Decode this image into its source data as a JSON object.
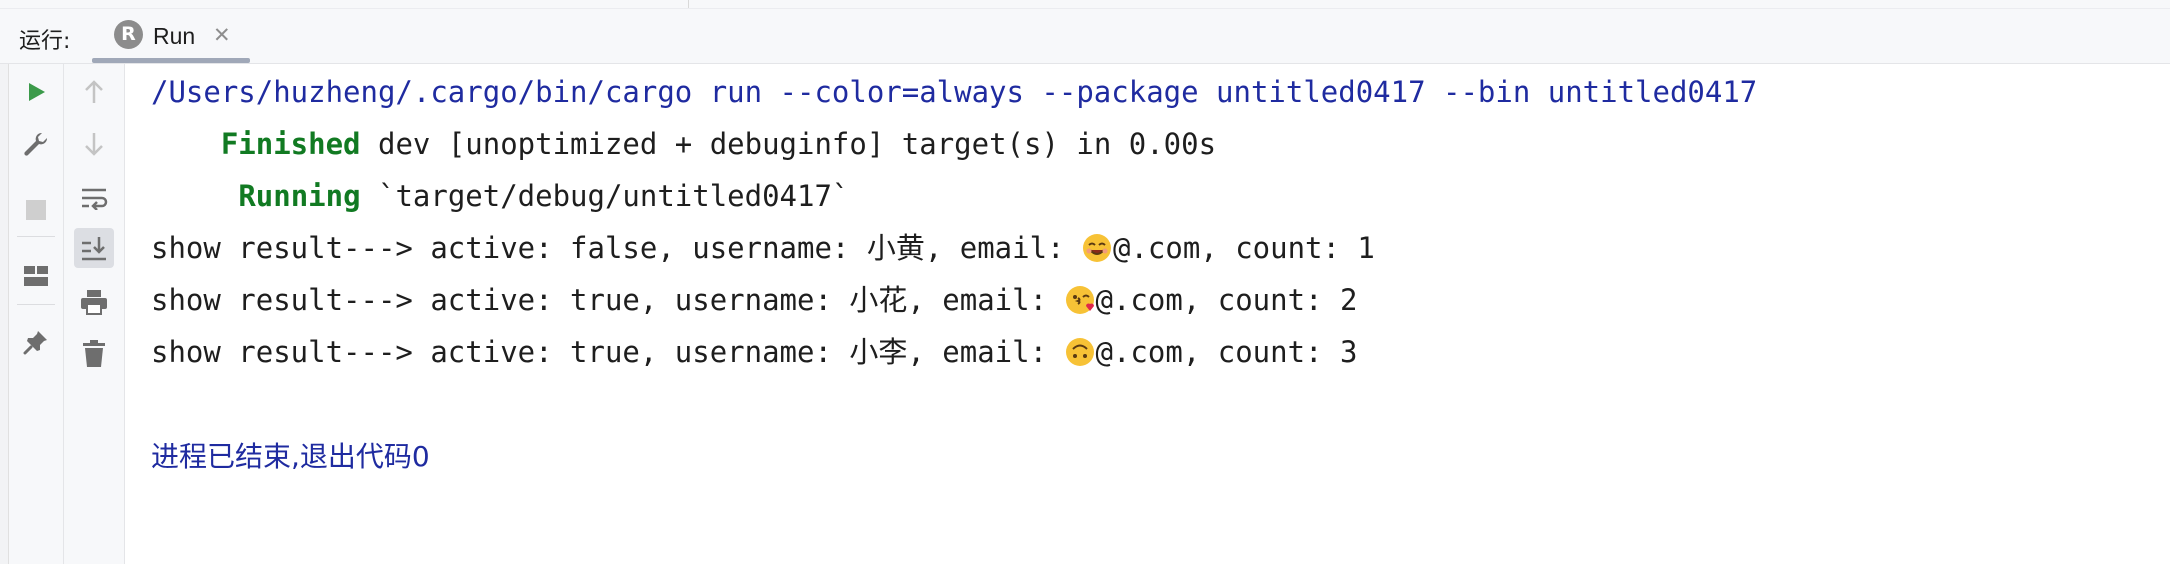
{
  "run_panel": {
    "label": "运行:",
    "tab": {
      "title": "Run",
      "logo_letter": "R",
      "close_glyph": "✕"
    }
  },
  "toolbar": {
    "left": [
      "run-icon",
      "wrench-icon",
      "stop-icon",
      "layout-icon",
      "pin-icon"
    ],
    "right": [
      "up-arrow-icon",
      "down-arrow-icon",
      "soft-wrap-icon",
      "scroll-to-end-icon",
      "print-icon",
      "trash-icon"
    ]
  },
  "console": {
    "command": "/Users/huzheng/.cargo/bin/cargo run --color=always --package untitled0417 --bin untitled0417",
    "finished_indent": "    ",
    "finished_status": "Finished",
    "finished_text": " dev [unoptimized + debuginfo] target(s) in 0.00s",
    "running_indent": "     ",
    "running_status": "Running",
    "running_text": " `target/debug/untitled0417`",
    "results": [
      {
        "prefix": "show result---> active: false, username: 小黄, email: ",
        "emoji": "smiling-face-emoji",
        "suffix": "@.com, count: 1"
      },
      {
        "prefix": "show result---> active: true, username: 小花, email: ",
        "emoji": "kissing-face-emoji",
        "suffix": "@.com, count: 2"
      },
      {
        "prefix": "show result---> active: true, username: 小李, email: ",
        "emoji": "upside-down-face-emoji",
        "suffix": "@.com, count: 3"
      }
    ],
    "exit_message": "进程已结束,退出代码0"
  },
  "colors": {
    "command": "#1f2ba0",
    "status": "#117a22",
    "text": "#1e1e1e",
    "run_icon": "#3b9a4a",
    "emoji_face": "#f7c236"
  }
}
